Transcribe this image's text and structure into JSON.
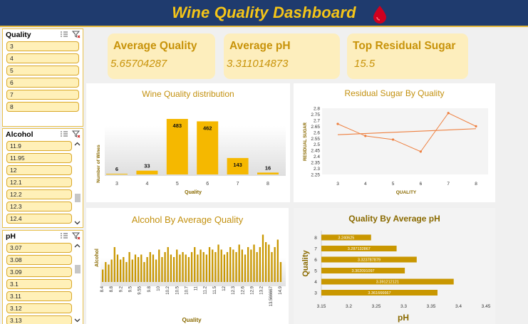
{
  "header": {
    "title": "Wine Quality Dashboard",
    "icon": "blood-drop-icon",
    "bg_color": "#1f3b6e",
    "title_color": "#f5c518"
  },
  "slicers": {
    "quality": {
      "title": "Quality",
      "items": [
        "3",
        "4",
        "5",
        "6",
        "7",
        "8"
      ]
    },
    "alcohol": {
      "title": "Alcohol",
      "items": [
        "11.9",
        "11.95",
        "12",
        "12.1",
        "12.2",
        "12.3",
        "12.4"
      ]
    },
    "ph": {
      "title": "pH",
      "items": [
        "3.07",
        "3.08",
        "3.09",
        "3.1",
        "3.11",
        "3.12",
        "3.13"
      ]
    }
  },
  "kpis": [
    {
      "label": "Average Quality",
      "value": "5.65704287"
    },
    {
      "label": "Average pH",
      "value": "3.311014873"
    },
    {
      "label": "Top Residual Sugar",
      "value": "15.5"
    }
  ],
  "colors": {
    "accent": "#c8930a",
    "bar": "#f5b800",
    "kpi_bg": "#fdeebd",
    "line": "#ee8040",
    "hbar": "#c99700"
  },
  "chart_data": [
    {
      "type": "bar",
      "title": "Wine Quality distribution",
      "xlabel": "Quality",
      "ylabel": "Number of Wines",
      "categories": [
        "3",
        "4",
        "5",
        "6",
        "7",
        "8"
      ],
      "values": [
        6,
        33,
        483,
        462,
        143,
        16
      ]
    },
    {
      "type": "line",
      "title": "Residual Sugar By Quality",
      "xlabel": "QUALITY",
      "ylabel": "RESIDUAL SUGAR",
      "categories": [
        "3",
        "4",
        "5",
        "6",
        "7",
        "8"
      ],
      "values": [
        2.67,
        2.57,
        2.54,
        2.44,
        2.76,
        2.65
      ],
      "trendline": [
        2.58,
        2.63
      ],
      "ylim": [
        2.25,
        2.8
      ],
      "yticks": [
        "2.25",
        "2.3",
        "2.35",
        "2.4",
        "2.45",
        "2.5",
        "2.55",
        "2.6",
        "2.65",
        "2.7",
        "2.75",
        "2.8"
      ]
    },
    {
      "type": "bar",
      "title": "Alcohol By Average Quality",
      "xlabel": "Quality",
      "ylabel": "Alcohol",
      "tick_labels": [
        "8.4",
        "8.8",
        "9.2",
        "9.5",
        "9.55",
        "9.8",
        "10",
        "10.2",
        "10.5",
        "10.7",
        "11",
        "11.2",
        "11.5",
        "12",
        "12.3",
        "12.6",
        "12.9",
        "13.2",
        "13.566667",
        "14.9"
      ],
      "values": [
        5.0,
        5.3,
        5.2,
        5.4,
        5.9,
        5.6,
        5.4,
        5.5,
        5.3,
        5.7,
        5.4,
        5.6,
        5.5,
        5.6,
        5.3,
        5.5,
        5.7,
        5.6,
        5.4,
        5.8,
        5.5,
        5.7,
        5.9,
        5.6,
        5.5,
        5.8,
        5.6,
        5.7,
        5.6,
        5.5,
        5.7,
        5.9,
        5.6,
        5.8,
        5.7,
        5.6,
        5.9,
        5.8,
        5.7,
        6.0,
        5.8,
        5.6,
        5.7,
        5.9,
        5.8,
        5.7,
        6.0,
        5.8,
        5.6,
        5.9,
        5.8,
        6.0,
        5.7,
        5.9,
        6.4,
        6.1,
        6.0,
        5.7,
        5.9,
        6.2,
        5.3
      ],
      "ylim": [
        4.5,
        6.5
      ]
    },
    {
      "type": "bar",
      "orientation": "horizontal",
      "title": "Quality By Average pH",
      "xlabel": "pH",
      "ylabel": "Quality",
      "categories": [
        "3",
        "4",
        "5",
        "6",
        "7",
        "8"
      ],
      "values": [
        3.361666667,
        3.391212121,
        3.302091097,
        3.323787879,
        3.287132867,
        3.240625
      ],
      "value_labels": [
        "3.361666667",
        "3.391212121",
        "3.302091097",
        "3.323787879",
        "3.287132867",
        "3.240625"
      ],
      "xlim": [
        3.15,
        3.45
      ],
      "xticks": [
        "3.15",
        "3.2",
        "3.25",
        "3.3",
        "3.35",
        "3.4",
        "3.45"
      ]
    }
  ]
}
